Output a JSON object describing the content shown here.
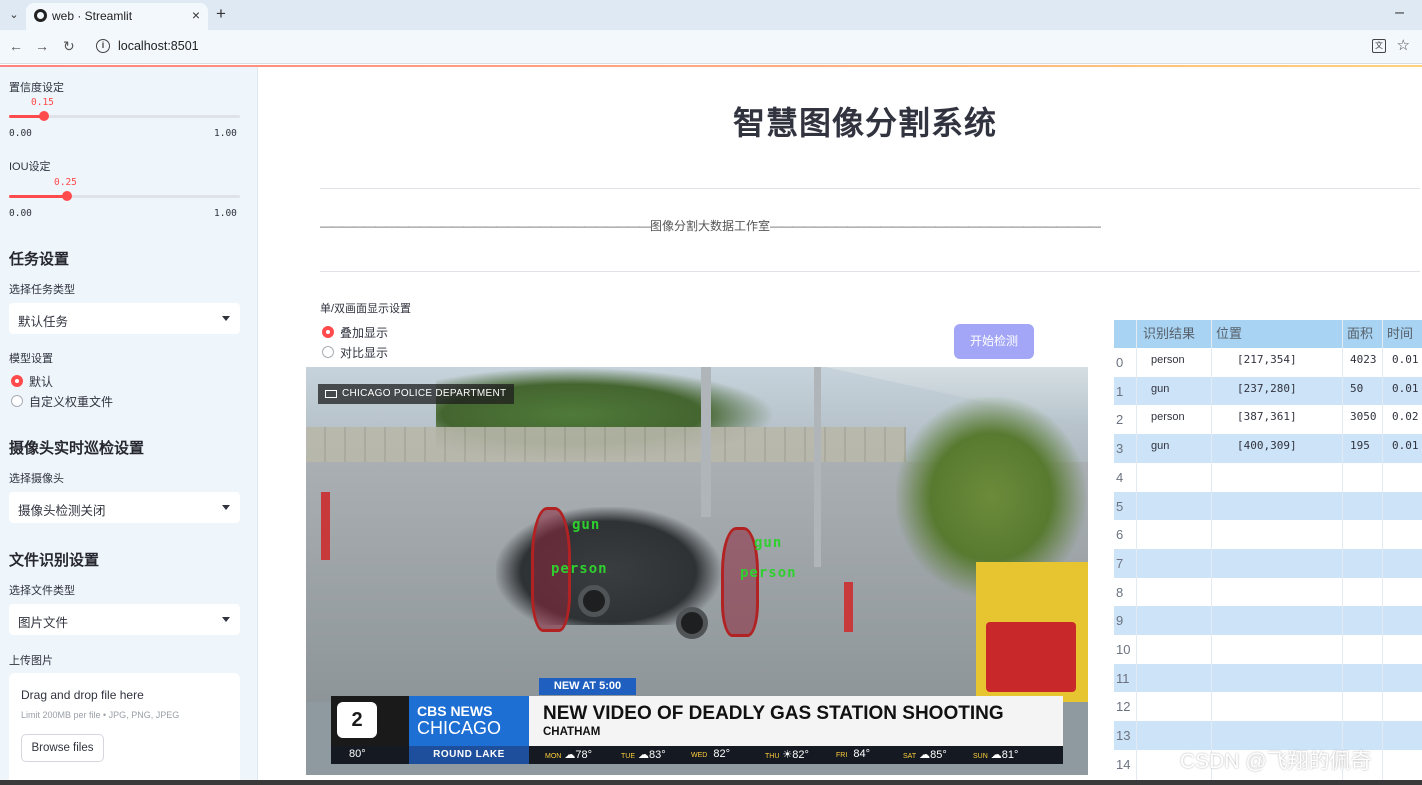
{
  "browser": {
    "tab_title": "web · Streamlit",
    "url": "localhost:8501",
    "new_tab": "+",
    "close": "×",
    "minimize": "–"
  },
  "sidebar": {
    "confidence": {
      "label": "置信度设定",
      "value": "0.15",
      "min": "0.00",
      "max": "1.00",
      "fraction": 0.15
    },
    "iou": {
      "label": "IOU设定",
      "value": "0.25",
      "min": "0.00",
      "max": "1.00",
      "fraction": 0.25
    },
    "task_header": "任务设置",
    "task_type_label": "选择任务类型",
    "task_type_value": "默认任务",
    "model_label": "模型设置",
    "model_options": [
      "默认",
      "自定义权重文件"
    ],
    "model_selected": 0,
    "camera_header": "摄像头实时巡检设置",
    "camera_label": "选择摄像头",
    "camera_value": "摄像头检测关闭",
    "file_header": "文件识别设置",
    "file_type_label": "选择文件类型",
    "file_type_value": "图片文件",
    "upload_label": "上传图片",
    "upload_title": "Drag and drop file here",
    "upload_limit": "Limit 200MB per file • JPG, PNG, JPEG",
    "browse_button": "Browse files"
  },
  "main": {
    "title": "智慧图像分割系统",
    "studio": "图像分割大数据工作室",
    "display_label": "单/双画面显示设置",
    "display_options": [
      "叠加显示",
      "对比显示"
    ],
    "display_selected": 0,
    "start_button": "开始检测"
  },
  "video": {
    "overlay_source": "CHICAGO POLICE DEPARTMENT",
    "detections": [
      "gun",
      "person",
      "gun",
      "person"
    ],
    "news_tag": "NEW AT 5:00",
    "logo_number": "2",
    "brand_top": "CBS NEWS",
    "brand_bottom": "CHICAGO",
    "headline": "NEW VIDEO OF DEADLY GAS STATION SHOOTING",
    "subline": "CHATHAM",
    "ticker_temp": "80°",
    "ticker_city": "ROUND LAKE",
    "forecast": [
      {
        "day": "MON",
        "temp": "78°"
      },
      {
        "day": "TUE",
        "temp": "83°"
      },
      {
        "day": "WED",
        "temp": "82°"
      },
      {
        "day": "THU",
        "temp": "82°"
      },
      {
        "day": "FRI",
        "temp": "84°"
      },
      {
        "day": "SAT",
        "temp": "85°"
      },
      {
        "day": "SUN",
        "temp": "81°"
      }
    ]
  },
  "results_table": {
    "headers": [
      "识别结果",
      "位置",
      "面积",
      "时间"
    ],
    "rows": [
      {
        "index": "0",
        "name": "person",
        "pos": "[217,354]",
        "area": "4023",
        "time": "0.01"
      },
      {
        "index": "1",
        "name": "gun",
        "pos": "[237,280]",
        "area": "50",
        "time": "0.01"
      },
      {
        "index": "2",
        "name": "person",
        "pos": "[387,361]",
        "area": "3050",
        "time": "0.02"
      },
      {
        "index": "3",
        "name": "gun",
        "pos": "[400,309]",
        "area": "195",
        "time": "0.01"
      },
      {
        "index": "4",
        "name": "",
        "pos": "",
        "area": "",
        "time": ""
      },
      {
        "index": "5",
        "name": "",
        "pos": "",
        "area": "",
        "time": ""
      },
      {
        "index": "6",
        "name": "",
        "pos": "",
        "area": "",
        "time": ""
      },
      {
        "index": "7",
        "name": "",
        "pos": "",
        "area": "",
        "time": ""
      },
      {
        "index": "8",
        "name": "",
        "pos": "",
        "area": "",
        "time": ""
      },
      {
        "index": "9",
        "name": "",
        "pos": "",
        "area": "",
        "time": ""
      },
      {
        "index": "10",
        "name": "",
        "pos": "",
        "area": "",
        "time": ""
      },
      {
        "index": "11",
        "name": "",
        "pos": "",
        "area": "",
        "time": ""
      },
      {
        "index": "12",
        "name": "",
        "pos": "",
        "area": "",
        "time": ""
      },
      {
        "index": "13",
        "name": "",
        "pos": "",
        "area": "",
        "time": ""
      },
      {
        "index": "14",
        "name": "",
        "pos": "",
        "area": "",
        "time": ""
      }
    ]
  },
  "watermark": "CSDN @飞翔的佩奇",
  "colors": {
    "accent": "#ff4b4b",
    "button": "#a3a6f7",
    "table_header": "#a8d3f3",
    "table_row_alt": "#cde3f7",
    "sidebar_bg": "#eef5fb"
  }
}
